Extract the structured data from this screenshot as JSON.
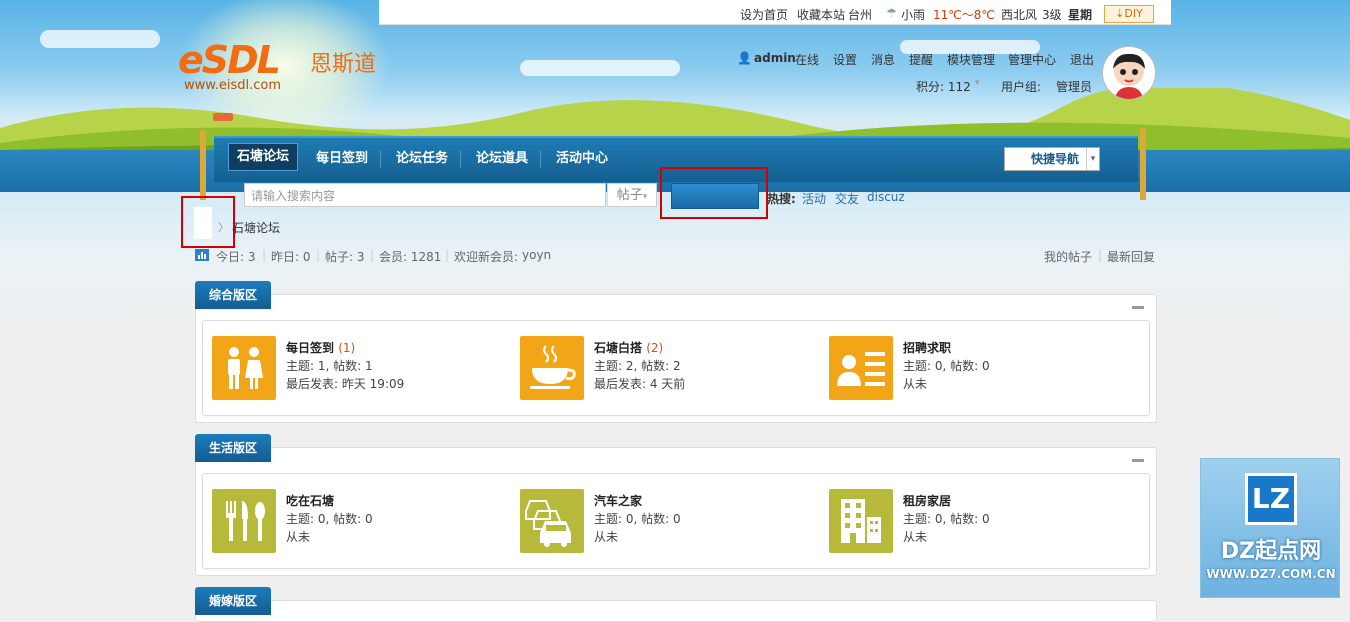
{
  "topbar": {
    "set_home": "设为首页",
    "bookmark": "收藏本站",
    "city": "台州",
    "weather": "小雨",
    "temp": "11℃～8℃",
    "wind": "西北风",
    "wind_level": "3级",
    "weekday": "星期",
    "diy": "DIY"
  },
  "logo": {
    "brand": "eSDL",
    "cn": "恩斯道",
    "url": "www.eisdl.com"
  },
  "user": {
    "name": "admin",
    "status": "在线",
    "links": [
      "设置",
      "消息",
      "提醒",
      "模块管理",
      "管理中心",
      "退出"
    ],
    "points_label": "积分: 112",
    "group_label": "用户组:",
    "group": "管理员"
  },
  "nav": {
    "items": [
      "石塘论坛",
      "每日签到",
      "论坛任务",
      "论坛道具",
      "活动中心"
    ],
    "quick": "快捷导航"
  },
  "search": {
    "placeholder": "请输入搜索内容",
    "type": "帖子",
    "hot_label": "热搜:",
    "hot": [
      "活动",
      "交友",
      "discuz"
    ]
  },
  "breadcrumb": {
    "current": "石塘论坛"
  },
  "stats": {
    "today": "今日: 3",
    "yesterday": "昨日: 0",
    "posts": "帖子: 3",
    "members": "会员: 1281",
    "welcome": "欢迎新会员:",
    "new_member": "yoyn",
    "my_posts": "我的帖子",
    "latest": "最新回复"
  },
  "categories": [
    {
      "name": "综合版区",
      "forums": [
        {
          "name": "每日签到",
          "count": "(1)",
          "stats": "主题: 1, 帖数: 1",
          "last": "最后发表: 昨天 19:09",
          "icon": "people-icon"
        },
        {
          "name": "石塘白搭",
          "count": "(2)",
          "stats": "主题: 2, 帖数: 2",
          "last": "最后发表: 4 天前",
          "icon": "coffee-cup-icon"
        },
        {
          "name": "招聘求职",
          "count": "",
          "stats": "主题: 0, 帖数: 0",
          "last": "从未",
          "icon": "id-card-icon"
        }
      ]
    },
    {
      "name": "生活版区",
      "forums": [
        {
          "name": "吃在石塘",
          "count": "",
          "stats": "主题: 0, 帖数: 0",
          "last": "从未",
          "icon": "cutlery-icon"
        },
        {
          "name": "汽车之家",
          "count": "",
          "stats": "主题: 0, 帖数: 0",
          "last": "从未",
          "icon": "car-icon"
        },
        {
          "name": "租房家居",
          "count": "",
          "stats": "主题: 0, 帖数: 0",
          "last": "从未",
          "icon": "building-icon"
        }
      ]
    },
    {
      "name": "婚嫁版区",
      "forums": []
    }
  ],
  "badge": {
    "logo": "LZ",
    "title": "DZ起点网",
    "url": "WWW.DZ7.COM.CN"
  },
  "colors": {
    "accent": "#1b6fa8",
    "orange_icon": "#f2a516",
    "olive_icon": "#b7b93a",
    "highlight": "#d40000"
  }
}
